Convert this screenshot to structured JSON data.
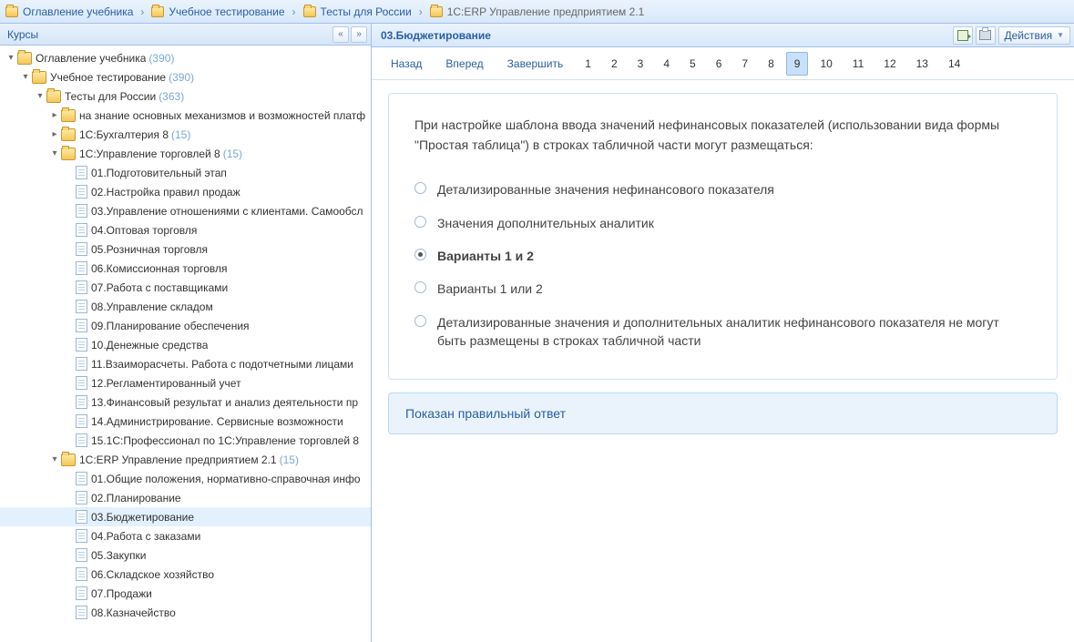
{
  "breadcrumb": [
    {
      "label": "Оглавление учебника",
      "kind": "folder"
    },
    {
      "label": "Учебное тестирование",
      "kind": "folder"
    },
    {
      "label": "Тесты для России",
      "kind": "folder"
    },
    {
      "label": "1С:ERP Управление предприятием 2.1",
      "kind": "folder"
    }
  ],
  "sidebar": {
    "title": "Курсы",
    "tree": [
      {
        "depth": 0,
        "caret": "down",
        "icon": "folder",
        "label": "Оглавление учебника",
        "count": "(390)"
      },
      {
        "depth": 1,
        "caret": "down",
        "icon": "folder",
        "label": "Учебное тестирование",
        "count": "(390)"
      },
      {
        "depth": 2,
        "caret": "down",
        "icon": "folder",
        "label": "Тесты для России",
        "count": "(363)"
      },
      {
        "depth": 3,
        "caret": "right",
        "icon": "folder",
        "label": "на знание основных механизмов и возможностей платф",
        "count": ""
      },
      {
        "depth": 3,
        "caret": "right",
        "icon": "folder",
        "label": "1С:Бухгалтерия 8",
        "count": "(15)"
      },
      {
        "depth": 3,
        "caret": "down",
        "icon": "folder",
        "label": "1С:Управление торговлей 8",
        "count": "(15)"
      },
      {
        "depth": 4,
        "caret": "",
        "icon": "page",
        "label": "01.Подготовительный этап"
      },
      {
        "depth": 4,
        "caret": "",
        "icon": "page",
        "label": "02.Настройка правил продаж"
      },
      {
        "depth": 4,
        "caret": "",
        "icon": "page",
        "label": "03.Управление отношениями с клиентами. Самообсл"
      },
      {
        "depth": 4,
        "caret": "",
        "icon": "page",
        "label": "04.Оптовая торговля"
      },
      {
        "depth": 4,
        "caret": "",
        "icon": "page",
        "label": "05.Розничная торговля"
      },
      {
        "depth": 4,
        "caret": "",
        "icon": "page",
        "label": "06.Комиссионная торговля"
      },
      {
        "depth": 4,
        "caret": "",
        "icon": "page",
        "label": "07.Работа с поставщиками"
      },
      {
        "depth": 4,
        "caret": "",
        "icon": "page",
        "label": "08.Управление складом"
      },
      {
        "depth": 4,
        "caret": "",
        "icon": "page",
        "label": "09.Планирование обеспечения"
      },
      {
        "depth": 4,
        "caret": "",
        "icon": "page",
        "label": "10.Денежные средства"
      },
      {
        "depth": 4,
        "caret": "",
        "icon": "page",
        "label": "11.Взаиморасчеты. Работа с подотчетными лицами"
      },
      {
        "depth": 4,
        "caret": "",
        "icon": "page",
        "label": "12.Регламентированный учет"
      },
      {
        "depth": 4,
        "caret": "",
        "icon": "page",
        "label": "13.Финансовый результат и анализ деятельности пр"
      },
      {
        "depth": 4,
        "caret": "",
        "icon": "page",
        "label": "14.Администрирование. Сервисные возможности"
      },
      {
        "depth": 4,
        "caret": "",
        "icon": "page",
        "label": "15.1С:Профессионал по 1С:Управление торговлей 8"
      },
      {
        "depth": 3,
        "caret": "down",
        "icon": "folder",
        "label": "1С:ERP Управление предприятием 2.1",
        "count": "(15)"
      },
      {
        "depth": 4,
        "caret": "",
        "icon": "page",
        "label": "01.Общие положения, нормативно-справочная инфо"
      },
      {
        "depth": 4,
        "caret": "",
        "icon": "page",
        "label": "02.Планирование"
      },
      {
        "depth": 4,
        "caret": "",
        "icon": "page",
        "label": "03.Бюджетирование",
        "selected": true
      },
      {
        "depth": 4,
        "caret": "",
        "icon": "page",
        "label": "04.Работа с заказами"
      },
      {
        "depth": 4,
        "caret": "",
        "icon": "page",
        "label": "05.Закупки"
      },
      {
        "depth": 4,
        "caret": "",
        "icon": "page",
        "label": "06.Складское хозяйство"
      },
      {
        "depth": 4,
        "caret": "",
        "icon": "page",
        "label": "07.Продажи"
      },
      {
        "depth": 4,
        "caret": "",
        "icon": "page",
        "label": "08.Казначейство"
      }
    ]
  },
  "content": {
    "title": "03.Бюджетирование",
    "actions_label": "Действия",
    "nav": {
      "back": "Назад",
      "forward": "Вперед",
      "finish": "Завершить",
      "pages": [
        "1",
        "2",
        "3",
        "4",
        "5",
        "6",
        "7",
        "8",
        "9",
        "10",
        "11",
        "12",
        "13",
        "14"
      ],
      "active_index": 8
    },
    "question": "При настройке шаблона ввода значений нефинансовых показателей (использовании вида формы \"Простая таблица\") в строках табличной части могут размещаться:",
    "options": [
      {
        "text": "Детализированные значения нефинансового показателя",
        "correct": false
      },
      {
        "text": "Значения дополнительных аналитик",
        "correct": false
      },
      {
        "text": "Варианты 1 и 2",
        "correct": true
      },
      {
        "text": "Варианты 1 или 2",
        "correct": false
      },
      {
        "text": "Детализированные значения и дополнительных аналитик нефинансового показателя не могут быть размещены в строках табличной части",
        "correct": false
      }
    ],
    "feedback": "Показан правильный ответ"
  }
}
